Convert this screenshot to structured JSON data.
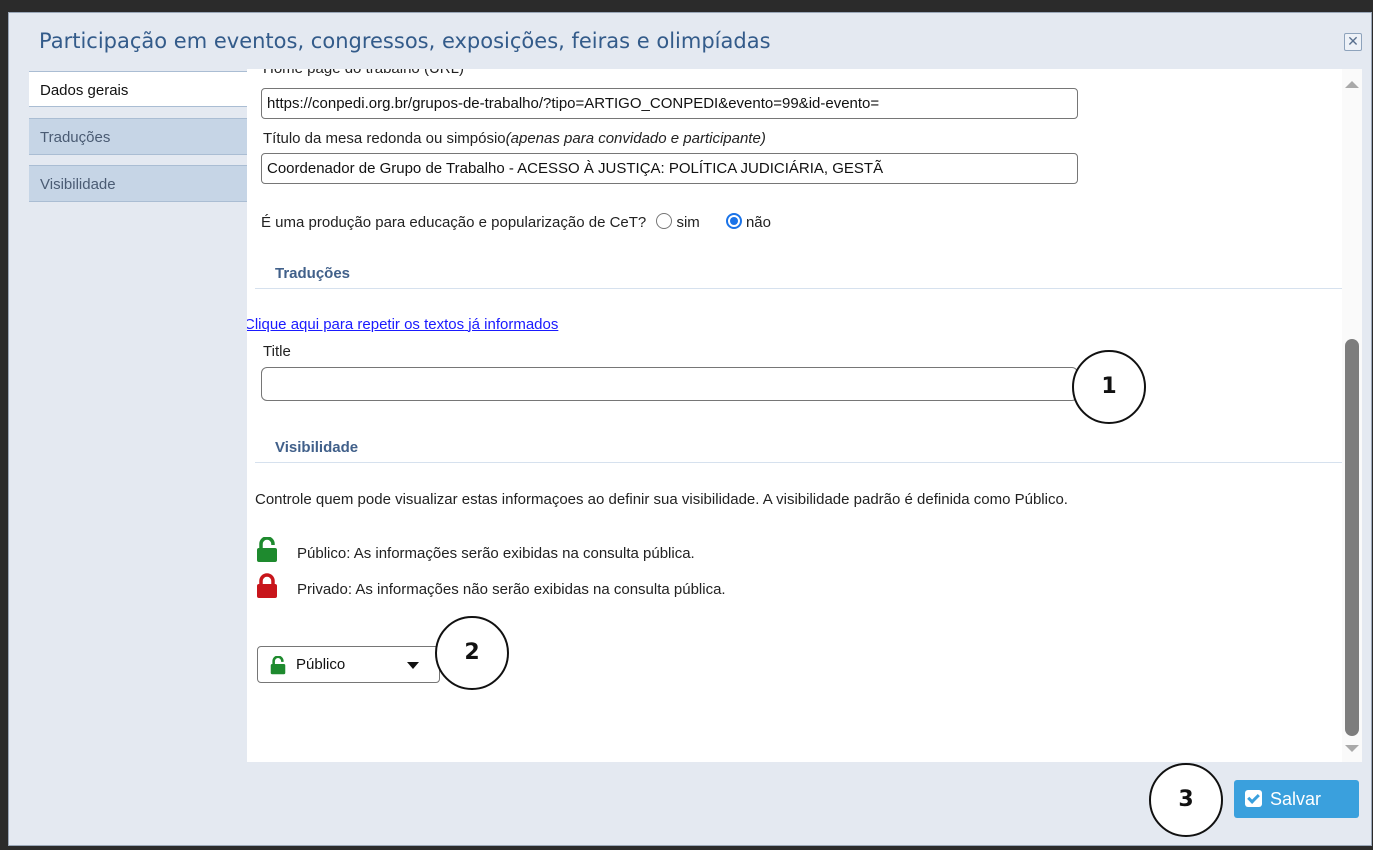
{
  "dialog": {
    "title": "Participação em eventos, congressos, exposições, feiras e olimpíadas",
    "close_icon": "close-icon"
  },
  "tabs": [
    {
      "label": "Dados gerais",
      "active": true
    },
    {
      "label": "Traduções",
      "active": false
    },
    {
      "label": "Visibilidade",
      "active": false
    }
  ],
  "form": {
    "homepage_label_cut": "Home page do trabalho (URL)",
    "homepage_value": "https://conpedi.org.br/grupos-de-trabalho/?tipo=ARTIGO_CONPEDI&evento=99&id-evento=",
    "mesa_label": "Título da mesa redonda ou simpósio",
    "mesa_label_note": "(apenas para convidado e participante)",
    "mesa_value": "Coordenador de Grupo de Trabalho - ACESSO À JUSTIÇA: POLÍTICA JUDICIÁRIA, GESTÃ",
    "educacao_question": "É uma produção para educação e popularização de CeT?",
    "educacao_options": [
      "sim",
      "não"
    ],
    "educacao_selected": "não"
  },
  "traducoes": {
    "heading": "Traduções",
    "repeat_link_1": "Clique aqui para repetir os textos",
    "repeat_link_2": "já informados",
    "title_label": "Title",
    "title_value": ""
  },
  "visibilidade": {
    "heading": "Visibilidade",
    "description": "Controle quem pode visualizar estas informaçoes ao definir sua visibilidade. A visibilidade padrão é definida como Público.",
    "public_text": "Público: As informações serão exibidas na consulta pública.",
    "private_text": "Privado: As informações não serão exibidas na consulta pública.",
    "select_value": "Público",
    "public_color": "#1e8a2e",
    "private_color": "#c8151b"
  },
  "callouts": [
    "1",
    "2",
    "3"
  ],
  "footer": {
    "save_label": "Salvar",
    "save_color": "#3aa0dd"
  }
}
